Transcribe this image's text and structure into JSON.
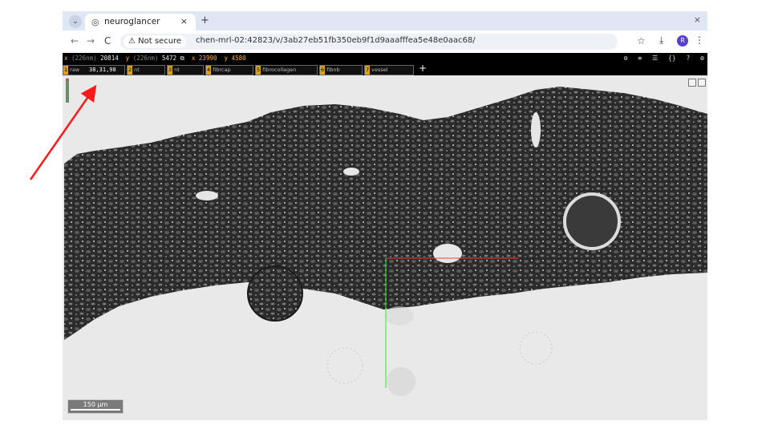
{
  "browser": {
    "tab_title": "neuroglancer",
    "tab_close": "×",
    "new_tab": "+",
    "window_close": "×",
    "tab_dropdown": "⌄",
    "back": "←",
    "forward": "→",
    "reload": "C",
    "security_label": "⚠ Not secure",
    "url": "chen-mrl-02:42823/v/3ab27eb51fb350eb9f1d9aaafffea5e48e0aac68/",
    "profile_initial": "R",
    "star": "☆",
    "download": "⤓",
    "menu": "⋮"
  },
  "neuroglancer": {
    "coords": {
      "x_axis": "x",
      "x_unit": "(226nm)",
      "x_value": "20814",
      "y_axis": "y",
      "y_unit": "(226nm)",
      "y_value": "5472",
      "copy_icon": "⧉",
      "mouse_x_label": "x",
      "mouse_x": "23990",
      "mouse_y_label": "y",
      "mouse_y": "4580"
    },
    "toolbar_icons": [
      "⚙",
      "≡",
      "☰",
      "{}",
      "?",
      "⚙"
    ],
    "layers": [
      {
        "num": "1",
        "name": "raw",
        "value": "38,31,98"
      },
      {
        "num": "2",
        "name": "nt",
        "value": ""
      },
      {
        "num": "3",
        "name": "nt",
        "value": ""
      },
      {
        "num": "4",
        "name": "fibrcap",
        "value": ""
      },
      {
        "num": "5",
        "name": "fibrocollagen",
        "value": ""
      },
      {
        "num": "6",
        "name": "fibnb",
        "value": ""
      },
      {
        "num": "7",
        "name": "vessel",
        "value": ""
      }
    ],
    "add_layer": "+",
    "scale_bar": "150 µm"
  },
  "colors": {
    "accent": "#ffaf3a",
    "annotation_arrow": "#ff1a1a",
    "crosshair_red": "#ff3b3b",
    "crosshair_green": "#32e332"
  }
}
